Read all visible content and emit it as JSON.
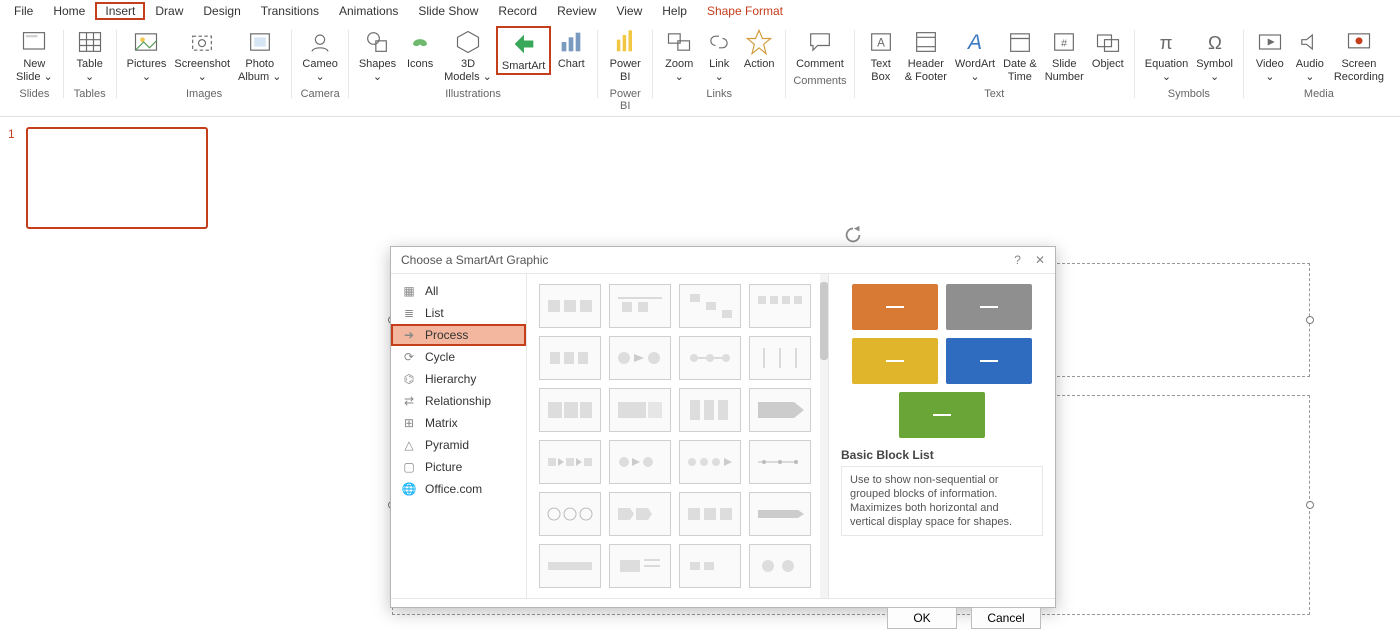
{
  "menu": {
    "file": "File",
    "home": "Home",
    "insert": "Insert",
    "draw": "Draw",
    "design": "Design",
    "transitions": "Transitions",
    "animations": "Animations",
    "slideshow": "Slide Show",
    "record": "Record",
    "review": "Review",
    "view": "View",
    "help": "Help",
    "shape_format": "Shape Format"
  },
  "ribbon": {
    "new_slide": "New\nSlide ⌄",
    "table": "Table\n⌄",
    "pictures": "Pictures\n⌄",
    "screenshot": "Screenshot\n⌄",
    "photo_album": "Photo\nAlbum ⌄",
    "cameo": "Cameo\n⌄",
    "shapes": "Shapes\n⌄",
    "icons": "Icons",
    "models": "3D\nModels ⌄",
    "smartart": "SmartArt",
    "chart": "Chart",
    "powerbi": "Power\nBI",
    "zoom": "Zoom\n⌄",
    "link": "Link\n⌄",
    "action": "Action",
    "comment": "Comment",
    "textbox": "Text\nBox",
    "headerfooter": "Header\n& Footer",
    "wordart": "WordArt\n⌄",
    "datetime": "Date &\nTime",
    "slidenumber": "Slide\nNumber",
    "object": "Object",
    "equation": "Equation\n⌄",
    "symbol": "Symbol\n⌄",
    "video": "Video\n⌄",
    "audio": "Audio\n⌄",
    "screenrec": "Screen\nRecording",
    "groups": {
      "slides": "Slides",
      "tables": "Tables",
      "images": "Images",
      "camera": "Camera",
      "illustrations": "Illustrations",
      "powerbi": "Power BI",
      "links": "Links",
      "comments": "Comments",
      "text": "Text",
      "symbols": "Symbols",
      "media": "Media"
    }
  },
  "slidepanel": {
    "num": "1"
  },
  "dialog": {
    "title": "Choose a SmartArt Graphic",
    "help": "?",
    "close": "✕",
    "categories": {
      "all": "All",
      "list": "List",
      "process": "Process",
      "cycle": "Cycle",
      "hierarchy": "Hierarchy",
      "relationship": "Relationship",
      "matrix": "Matrix",
      "pyramid": "Pyramid",
      "picture": "Picture",
      "office": "Office.com"
    },
    "preview": {
      "title": "Basic Block List",
      "desc": "Use to show non-sequential or grouped blocks of information. Maximizes both horizontal and vertical display space for shapes.",
      "colors": {
        "c1": "#d97a34",
        "c2": "#8f8f8f",
        "c3": "#e0b42b",
        "c4": "#2f6bbf",
        "c5": "#6aa637"
      }
    },
    "ok": "OK",
    "cancel": "Cancel"
  }
}
